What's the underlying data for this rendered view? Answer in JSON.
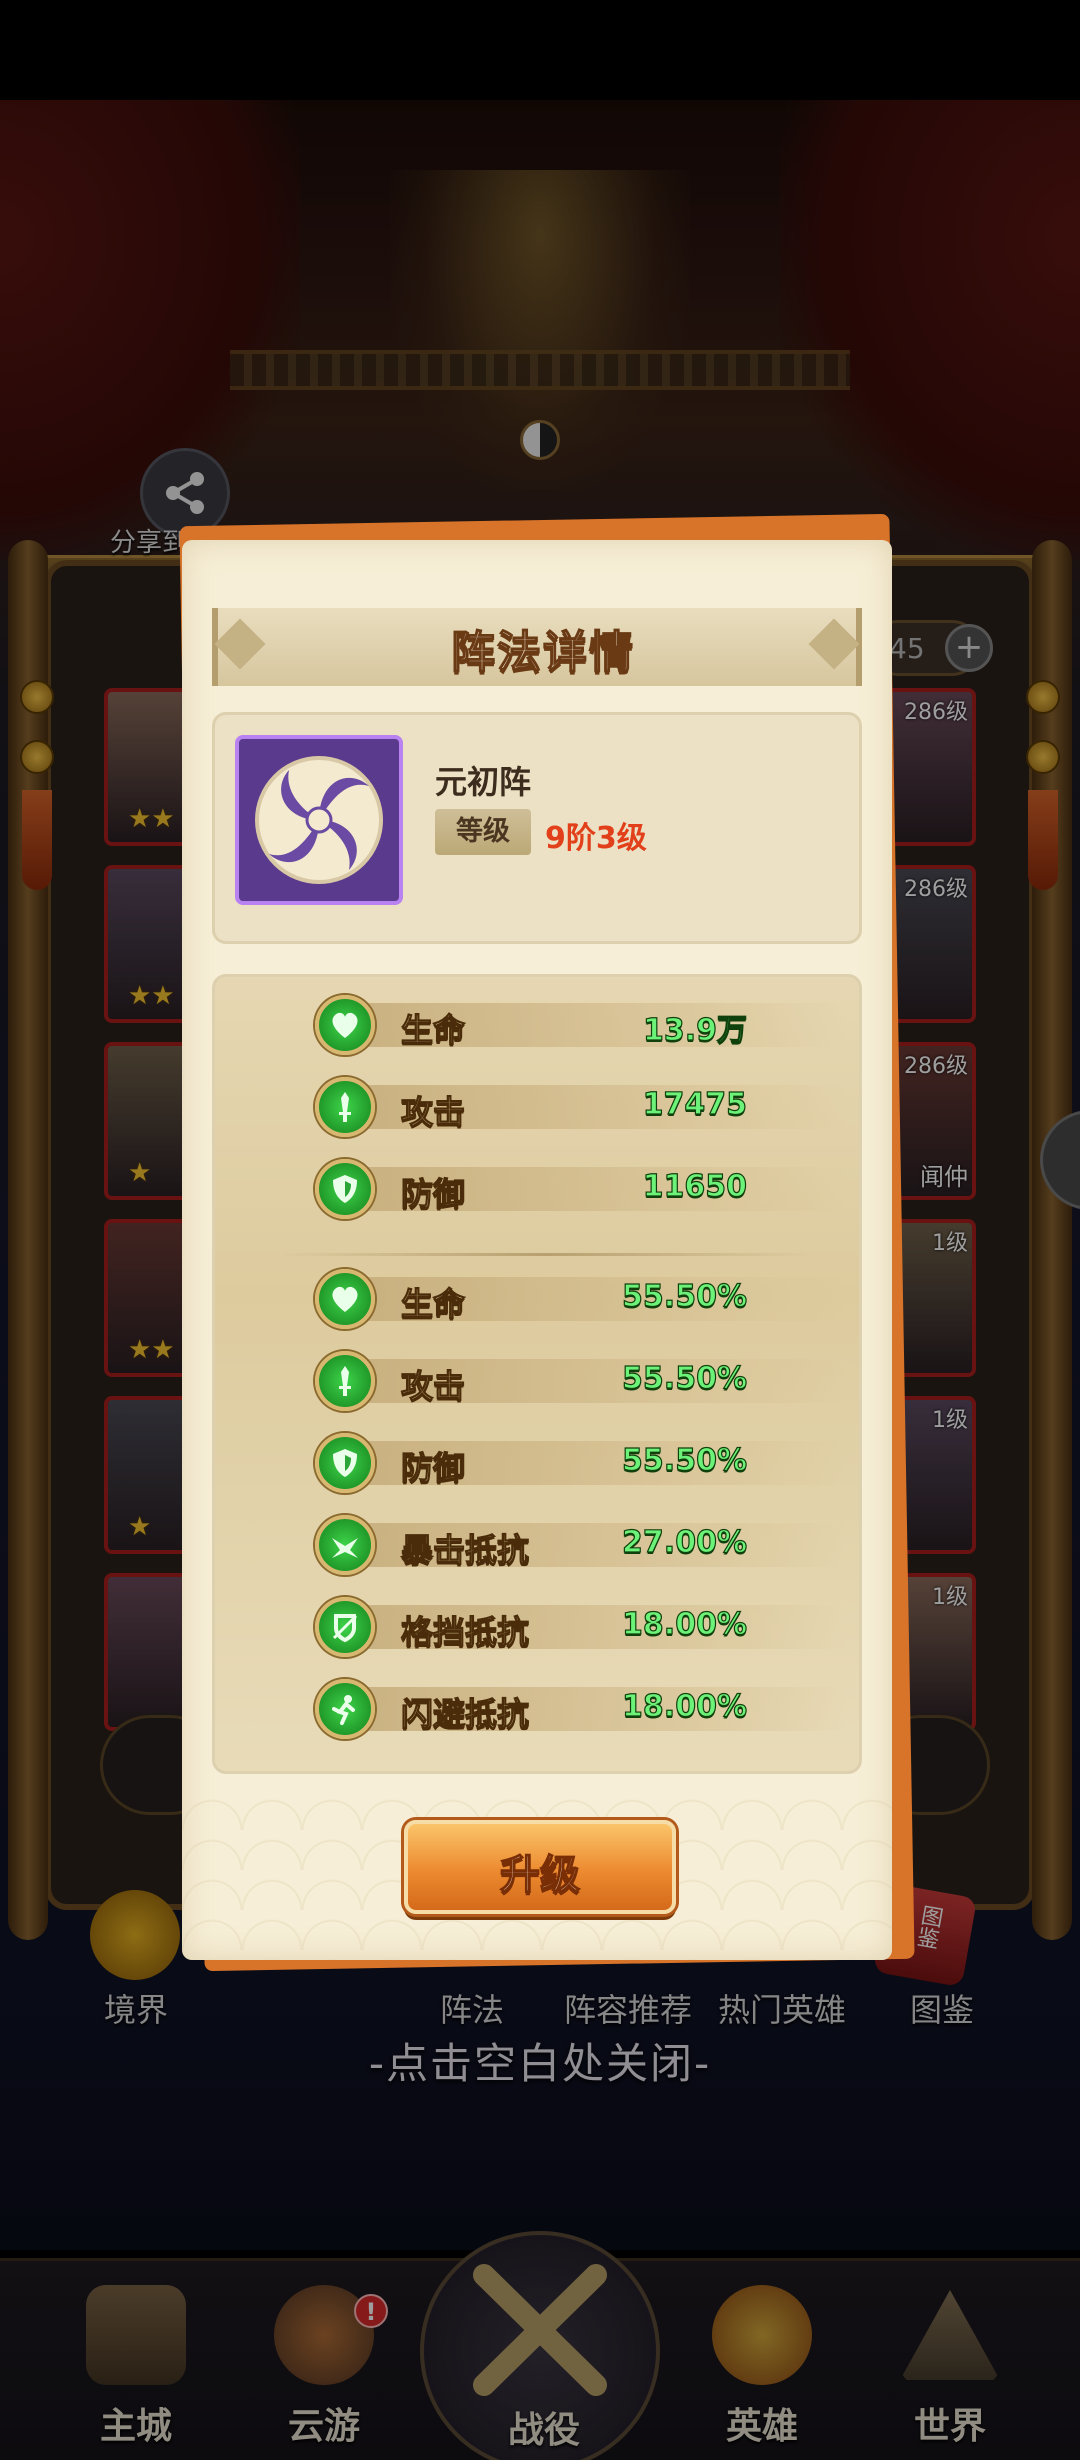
{
  "background": {
    "share_label": "分享到聊天",
    "side_count": "45",
    "side_plus": "+",
    "heroes_left": [
      {
        "level": "",
        "stars": "★★"
      },
      {
        "level": "",
        "stars": "★★"
      },
      {
        "level": "",
        "stars": "★"
      },
      {
        "level": "",
        "stars": "★★"
      },
      {
        "level": "",
        "stars": "★"
      },
      {
        "level": "",
        "stars": ""
      }
    ],
    "heroes_right": [
      {
        "level": "286级",
        "name": ""
      },
      {
        "level": "286级",
        "name": ""
      },
      {
        "level": "286级",
        "name": "闻仲"
      },
      {
        "level": "1级",
        "name": ""
      },
      {
        "level": "1级",
        "name": ""
      },
      {
        "level": "1级",
        "name": ""
      }
    ],
    "menu": {
      "realm": "境界",
      "formation": "阵法",
      "lineup": "阵容推荐",
      "hot_heroes": "热门英雄",
      "atlas": "图鉴",
      "atlas_icon_text": "图鉴"
    },
    "close_hint": "-点击空白处关闭-"
  },
  "bottom_nav": {
    "items": [
      {
        "label": "主城",
        "icon": "palace-icon"
      },
      {
        "label": "云游",
        "icon": "taichi-icon"
      },
      {
        "label": "战役",
        "icon": "crossed-swords-icon"
      },
      {
        "label": "英雄",
        "icon": "hero-icon"
      },
      {
        "label": "世界",
        "icon": "mountain-icon"
      }
    ],
    "notify": "!"
  },
  "dialog": {
    "title": "阵法详情",
    "formation": {
      "name": "元初阵",
      "level_label": "等级",
      "level_value": "9阶3级"
    },
    "base_stats": [
      {
        "name": "生命",
        "value": "13.9万",
        "icon": "heart-icon"
      },
      {
        "name": "攻击",
        "value": "17475",
        "icon": "sword-icon"
      },
      {
        "name": "防御",
        "value": "11650",
        "icon": "shield-icon"
      }
    ],
    "bonus_stats": [
      {
        "name": "生命",
        "value": "55.50%",
        "icon": "heart-icon"
      },
      {
        "name": "攻击",
        "value": "55.50%",
        "icon": "sword-icon"
      },
      {
        "name": "防御",
        "value": "55.50%",
        "icon": "shield-icon"
      },
      {
        "name": "暴击抵抗",
        "value": "27.00%",
        "icon": "crit-resist-icon"
      },
      {
        "name": "格挡抵抗",
        "value": "18.00%",
        "icon": "block-resist-icon"
      },
      {
        "name": "闪避抵抗",
        "value": "18.00%",
        "icon": "dodge-resist-icon"
      }
    ],
    "upgrade_label": "升级"
  },
  "colors": {
    "accent_orange": "#ec8a30",
    "stat_green": "#6cf278",
    "level_red": "#e2401a",
    "icon_purple": "#5a3a8c"
  }
}
